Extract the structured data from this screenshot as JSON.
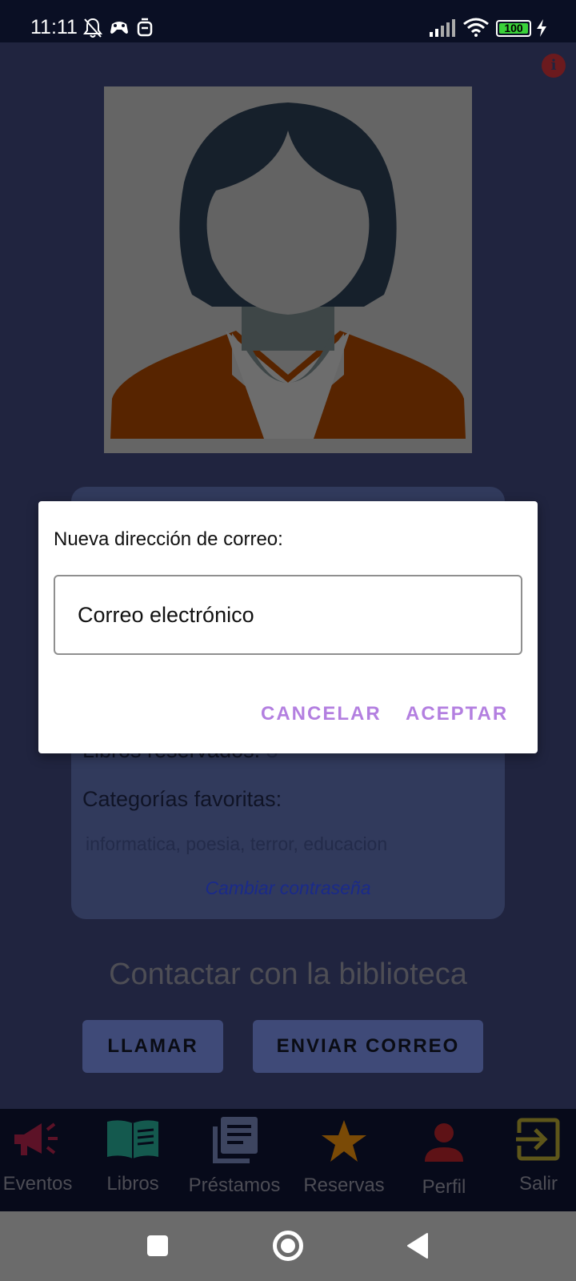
{
  "status_bar": {
    "time": "11:11",
    "battery": "100"
  },
  "profile": {
    "card": {
      "reserved_label": "Libros reservados:",
      "reserved_count": "3",
      "favorites_label": "Categorías favoritas:",
      "favorites_value": "informatica, poesia, terror, educacion",
      "change_password": "Cambiar contraseña"
    },
    "contact_title": "Contactar con la biblioteca",
    "call_button": "LLAMAR",
    "email_button": "ENVIAR CORREO"
  },
  "bottom_nav": {
    "items": [
      {
        "label": "Eventos",
        "icon": "megaphone-icon",
        "color": "#5c1227"
      },
      {
        "label": "Libros",
        "icon": "book-icon",
        "color": "#14594e"
      },
      {
        "label": "Préstamos",
        "icon": "documents-icon",
        "color": "#3d4560"
      },
      {
        "label": "Reservas",
        "icon": "star-icon",
        "color": "#7a4a06"
      },
      {
        "label": "Perfil",
        "icon": "person-icon",
        "color": "#5e1216"
      },
      {
        "label": "Salir",
        "icon": "exit-icon",
        "color": "#5e561a"
      }
    ]
  },
  "dialog": {
    "title": "Nueva dirección de correo:",
    "input_placeholder": "Correo electrónico",
    "cancel": "CANCELAR",
    "accept": "ACEPTAR"
  },
  "colors": {
    "dialog_action": "#b37fe0",
    "app_background": "#20243f",
    "status_bar": "#0a0f24"
  }
}
